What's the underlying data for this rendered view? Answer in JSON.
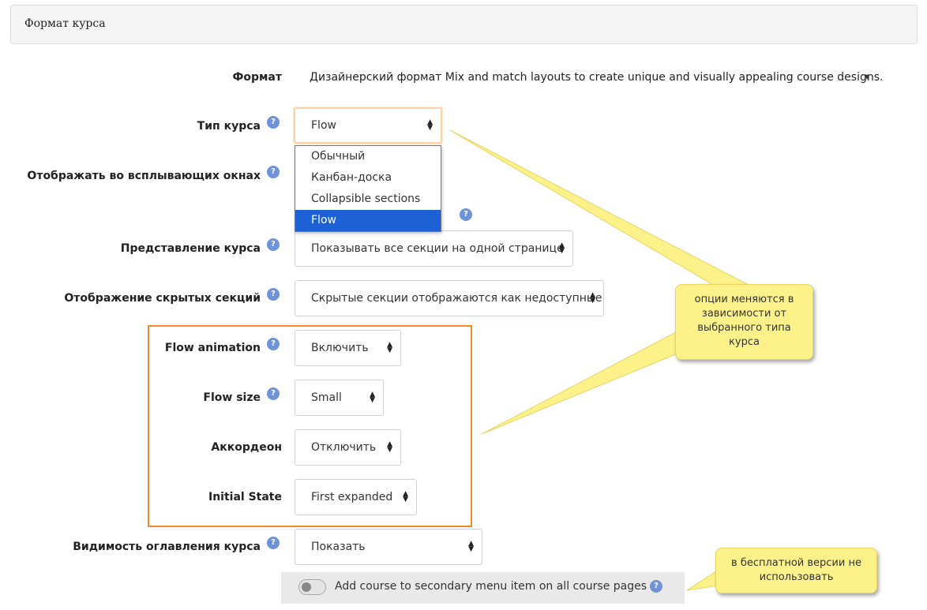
{
  "section": {
    "title": "Формат курса"
  },
  "fields": {
    "format": {
      "label": "Формат",
      "value": "Дизайнерский формат Mix and match layouts to create unique and visually appealing course designs."
    },
    "course_type": {
      "label": "Тип курса",
      "value": "Flow"
    },
    "popups": {
      "label": "Отображать во всплывающих окнах"
    },
    "course_view": {
      "label": "Представление курса",
      "value": "Показывать все секции на одной странице"
    },
    "hidden_sections": {
      "label": "Отображение скрытых секций",
      "value": "Скрытые секции отображаются как недоступные"
    },
    "flow_animation": {
      "label": "Flow animation",
      "value": "Включить"
    },
    "flow_size": {
      "label": "Flow size",
      "value": "Small"
    },
    "accordion": {
      "label": "Аккордеон",
      "value": "Отключить"
    },
    "initial_state": {
      "label": "Initial State",
      "value": "First expanded"
    },
    "toc_visibility": {
      "label": "Видимость оглавления курса",
      "value": "Показать"
    },
    "secondary_menu": {
      "label": "Add course to secondary menu item on all course pages",
      "enabled": false
    }
  },
  "course_type_options": [
    "Обычный",
    "Канбан-доска",
    "Collapsible sections",
    "Flow"
  ],
  "course_type_selected_index": 3,
  "callouts": {
    "options_change": "опции меняются в зависимости от выбранного типа курса",
    "free_version": "в бесплатной версии не использовать"
  },
  "colors": {
    "highlight_box": "#ee8a2a",
    "callout_fill": "#fdf28a",
    "selected_option": "#1c62d6",
    "help_icon": "#6f93d8"
  }
}
